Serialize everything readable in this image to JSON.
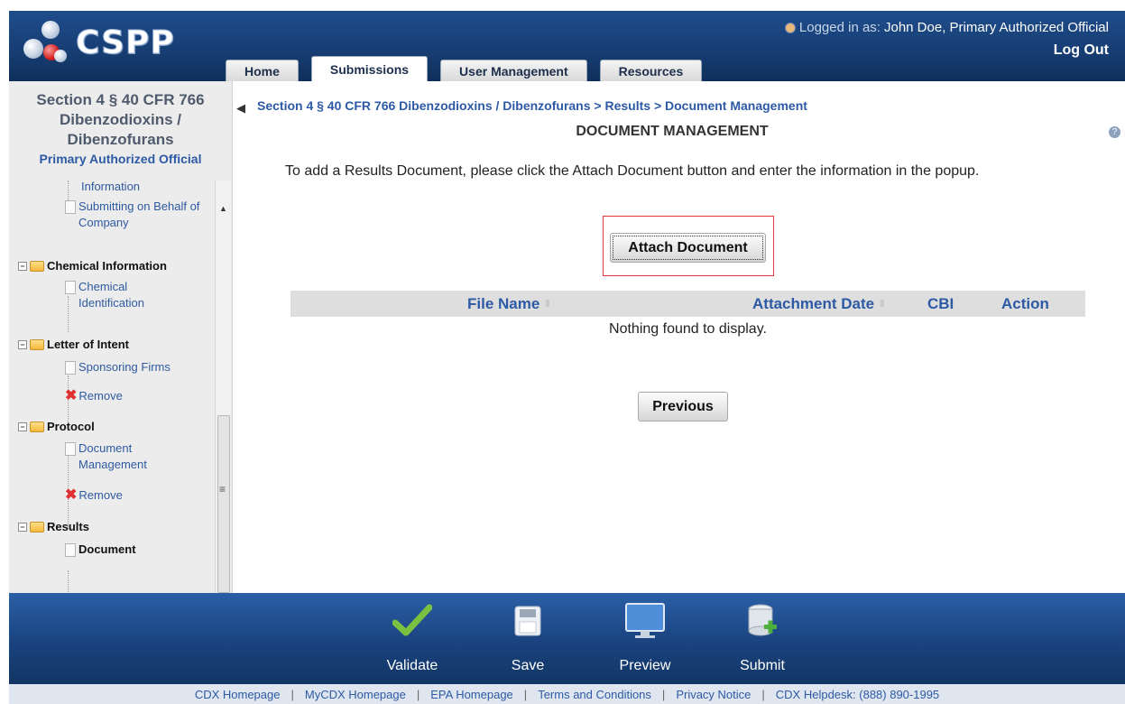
{
  "app": {
    "logo_text": "CSPP"
  },
  "header": {
    "login_prefix": "Logged in as:",
    "login_user": "John Doe, Primary Authorized Official",
    "logout": "Log Out",
    "tabs": [
      {
        "label": "Home"
      },
      {
        "label": "Submissions"
      },
      {
        "label": "User Management"
      },
      {
        "label": "Resources"
      }
    ],
    "active_tab": "Submissions"
  },
  "sidebar": {
    "title_line1": "Section 4 § 40 CFR 766",
    "title_line2": "Dibenzodioxins /",
    "title_line3": "Dibenzofurans",
    "role": "Primary Authorized Official",
    "items": [
      {
        "label": "Information",
        "kind": "leaf"
      },
      {
        "label": "Submitting on Behalf of Company",
        "kind": "leaf"
      },
      {
        "label": "Chemical Information",
        "kind": "group"
      },
      {
        "label": "Chemical Identification",
        "kind": "leaf"
      },
      {
        "label": "Letter of Intent",
        "kind": "group"
      },
      {
        "label": "Sponsoring Firms",
        "kind": "leaf"
      },
      {
        "label": "Remove",
        "kind": "remove"
      },
      {
        "label": "Protocol",
        "kind": "group"
      },
      {
        "label": "Document Management",
        "kind": "leaf"
      },
      {
        "label": "Remove",
        "kind": "remove"
      },
      {
        "label": "Results",
        "kind": "group"
      },
      {
        "label": "Document",
        "kind": "leaf-selected"
      }
    ]
  },
  "main": {
    "breadcrumb": "Section 4 § 40 CFR 766 Dibenzodioxins / Dibenzofurans > Results > Document Management",
    "title": "DOCUMENT MANAGEMENT",
    "instructions": "To add a Results Document, please click the Attach Document button and enter the information in the popup.",
    "attach_button": "Attach Document",
    "table": {
      "columns": [
        "File Name",
        "Attachment Date",
        "CBI",
        "Action"
      ],
      "empty_message": "Nothing found to display."
    },
    "previous_button": "Previous"
  },
  "toolbar": {
    "items": [
      {
        "label": "Validate",
        "icon": "checkmark-icon"
      },
      {
        "label": "Save",
        "icon": "floppy-disk-icon"
      },
      {
        "label": "Preview",
        "icon": "monitor-icon"
      },
      {
        "label": "Submit",
        "icon": "database-add-icon"
      }
    ]
  },
  "footer": {
    "links": [
      "CDX Homepage",
      "MyCDX Homepage",
      "EPA Homepage",
      "Terms and Conditions",
      "Privacy Notice",
      "CDX Helpdesk: (888) 890-1995"
    ]
  },
  "colors": {
    "header_blue": "#1f4d8c",
    "link_blue": "#2d5aa5",
    "highlight_red": "#e03a3a",
    "validate_green": "#7ac142"
  }
}
